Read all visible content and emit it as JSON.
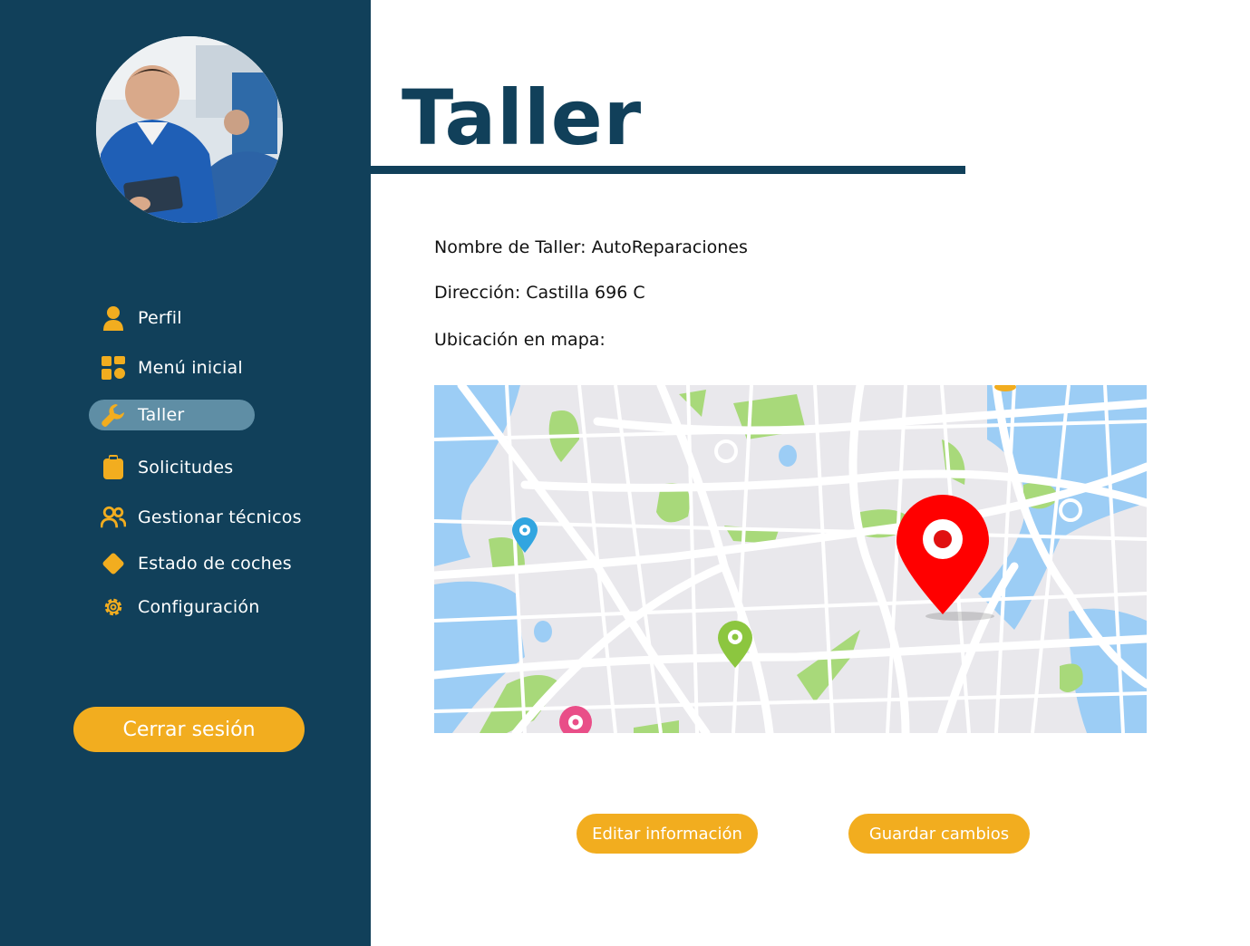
{
  "sidebar": {
    "avatar_alt": "Mecánico con tablet",
    "items": [
      {
        "label": "Perfil",
        "icon": "user-icon",
        "active": false
      },
      {
        "label": "Menú inicial",
        "icon": "dashboard-icon",
        "active": false
      },
      {
        "label": "Taller",
        "icon": "wrench-icon",
        "active": true
      },
      {
        "label": "Solicitudes",
        "icon": "clipboard-icon",
        "active": false
      },
      {
        "label": "Gestionar técnicos",
        "icon": "users-icon",
        "active": false
      },
      {
        "label": "Estado de coches",
        "icon": "diamond-icon",
        "active": false
      },
      {
        "label": "Configuración",
        "icon": "gear-icon",
        "active": false
      }
    ],
    "logout_label": "Cerrar sesión"
  },
  "main": {
    "title": "Taller",
    "workshop_name": "Nombre de Taller: AutoReparaciones",
    "address": "Dirección: Castilla 696 C",
    "map_label": "Ubicación en mapa:",
    "edit_label": "Editar información",
    "save_label": "Guardar cambios"
  },
  "colors": {
    "sidebar_bg": "#11405a",
    "accent": "#f2ad1f",
    "active_item": "#5f8ea5",
    "title": "#11405a"
  }
}
